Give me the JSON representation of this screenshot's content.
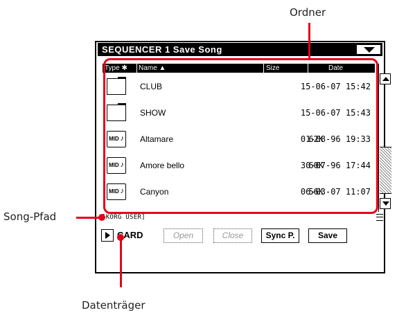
{
  "callouts": {
    "ordner": "Ordner",
    "song_pfad": "Song-Pfad",
    "datentraeger": "Datenträger"
  },
  "window": {
    "title": "SEQUENCER 1 Save Song"
  },
  "header": {
    "type": "Type ✱",
    "name": "Name ▲",
    "size": "Size",
    "date": "Date"
  },
  "files": [
    {
      "icon": "folder-icon",
      "name": "CLUB",
      "size": "",
      "date": "15-06-07 15:42"
    },
    {
      "icon": "folder-icon",
      "name": "SHOW",
      "size": "",
      "date": "15-06-07 15:43"
    },
    {
      "icon": "midi-file-icon",
      "name": "Altamare",
      "size": "62K",
      "date": "01-08-96 19:33"
    },
    {
      "icon": "midi-file-icon",
      "name": "Amore bello",
      "size": "60K",
      "date": "30-07-96 17:44"
    },
    {
      "icon": "midi-file-icon",
      "name": "Canyon",
      "size": "56K",
      "date": "06-03-07 11:07"
    }
  ],
  "midi_label": "MID",
  "path": "[KORG USER]",
  "drive": "CARD",
  "buttons": {
    "open": "Open",
    "close": "Close",
    "sync": "Sync P.",
    "save": "Save"
  },
  "colors": {
    "callout": "#e3001b",
    "screen_bg": "#ffffff",
    "bars": "#000000"
  }
}
